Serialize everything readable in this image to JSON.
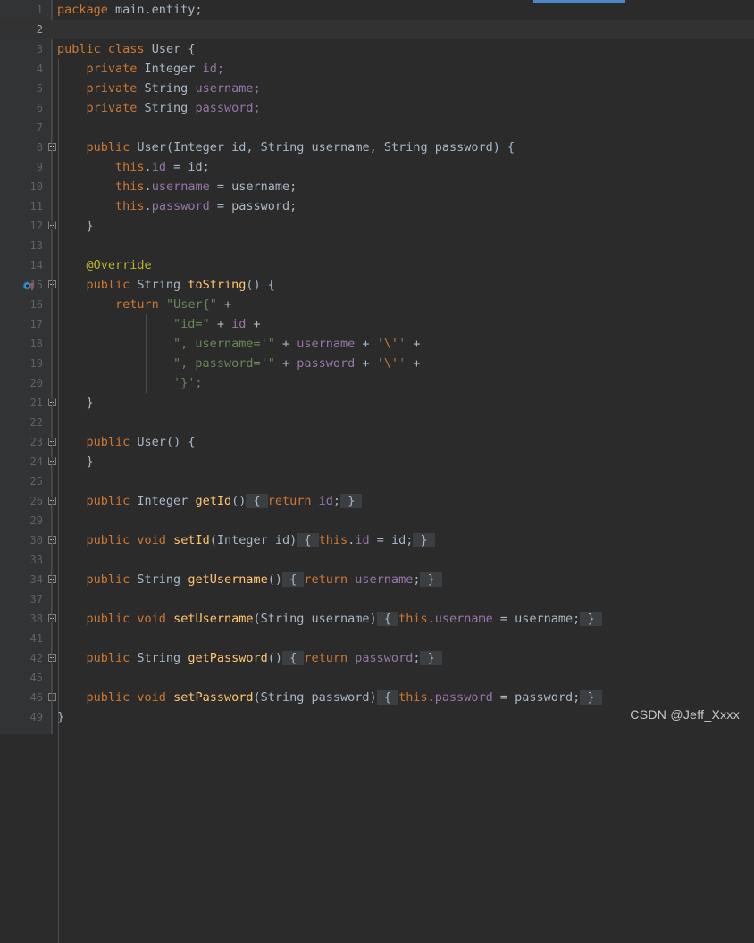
{
  "app": {
    "theme": "darcula",
    "colors": {
      "editor_background": "#2b2b2b",
      "gutter_background": "#313335",
      "current_line": "#323232",
      "keyword": "#cc7832",
      "string": "#6a8759",
      "field": "#9876aa",
      "method": "#ffc66d",
      "annotation": "#bbb529",
      "default_text": "#a9b7c6",
      "line_number": "#606366",
      "fold_placeholder_bg": "#3c3f41",
      "tab_indicator": "#4a88c7"
    }
  },
  "watermark": {
    "text": "CSDN @Jeff_Xxxx"
  },
  "gutter": {
    "override_icon_line": 15,
    "override_icon_name": "overriding-method-icon"
  },
  "editor": {
    "language": "java",
    "lines": [
      {
        "n": "1",
        "current": false,
        "indent": 0,
        "tokens": [
          {
            "t": "package ",
            "c": "kw"
          },
          {
            "t": "main.entity;",
            "c": "id"
          }
        ]
      },
      {
        "n": "2",
        "current": true,
        "indent": 0,
        "tokens": []
      },
      {
        "n": "3",
        "current": false,
        "indent": 0,
        "tokens": [
          {
            "t": "public ",
            "c": "kw"
          },
          {
            "t": "class ",
            "c": "kw"
          },
          {
            "t": "User ",
            "c": "cls"
          },
          {
            "t": "{",
            "c": "id"
          }
        ]
      },
      {
        "n": "4",
        "current": false,
        "indent": 1,
        "tokens": [
          {
            "t": "private ",
            "c": "kw"
          },
          {
            "t": "Integer ",
            "c": "id"
          },
          {
            "t": "id;",
            "c": "fld"
          }
        ]
      },
      {
        "n": "5",
        "current": false,
        "indent": 1,
        "tokens": [
          {
            "t": "private ",
            "c": "kw"
          },
          {
            "t": "String ",
            "c": "id"
          },
          {
            "t": "username;",
            "c": "fld"
          }
        ]
      },
      {
        "n": "6",
        "current": false,
        "indent": 1,
        "tokens": [
          {
            "t": "private ",
            "c": "kw"
          },
          {
            "t": "String ",
            "c": "id"
          },
          {
            "t": "password;",
            "c": "fld"
          }
        ]
      },
      {
        "n": "7",
        "current": false,
        "indent": 0,
        "tokens": []
      },
      {
        "n": "8",
        "current": false,
        "indent": 1,
        "fold": "start",
        "tokens": [
          {
            "t": "public ",
            "c": "kw"
          },
          {
            "t": "User",
            "c": "cls"
          },
          {
            "t": "(",
            "c": "id"
          },
          {
            "t": "Integer ",
            "c": "id"
          },
          {
            "t": "id",
            "c": "id"
          },
          {
            "t": ", ",
            "c": "id"
          },
          {
            "t": "String ",
            "c": "id"
          },
          {
            "t": "username",
            "c": "id"
          },
          {
            "t": ", ",
            "c": "id"
          },
          {
            "t": "String ",
            "c": "id"
          },
          {
            "t": "password",
            "c": "id"
          },
          {
            "t": ") {",
            "c": "id"
          }
        ]
      },
      {
        "n": "9",
        "current": false,
        "indent": 2,
        "tokens": [
          {
            "t": "this",
            "c": "kw"
          },
          {
            "t": ".",
            "c": "id"
          },
          {
            "t": "id",
            "c": "fld"
          },
          {
            "t": " = ",
            "c": "id"
          },
          {
            "t": "id;",
            "c": "id"
          }
        ]
      },
      {
        "n": "10",
        "current": false,
        "indent": 2,
        "tokens": [
          {
            "t": "this",
            "c": "kw"
          },
          {
            "t": ".",
            "c": "id"
          },
          {
            "t": "username",
            "c": "fld"
          },
          {
            "t": " = ",
            "c": "id"
          },
          {
            "t": "username;",
            "c": "id"
          }
        ]
      },
      {
        "n": "11",
        "current": false,
        "indent": 2,
        "tokens": [
          {
            "t": "this",
            "c": "kw"
          },
          {
            "t": ".",
            "c": "id"
          },
          {
            "t": "password",
            "c": "fld"
          },
          {
            "t": " = ",
            "c": "id"
          },
          {
            "t": "password;",
            "c": "id"
          }
        ]
      },
      {
        "n": "12",
        "current": false,
        "indent": 1,
        "fold": "end",
        "tokens": [
          {
            "t": "}",
            "c": "id"
          }
        ]
      },
      {
        "n": "13",
        "current": false,
        "indent": 0,
        "tokens": []
      },
      {
        "n": "14",
        "current": false,
        "indent": 1,
        "tokens": [
          {
            "t": "@Override",
            "c": "ann"
          }
        ]
      },
      {
        "n": "15",
        "current": false,
        "indent": 1,
        "fold": "start",
        "icon": "overriding-method-icon",
        "tokens": [
          {
            "t": "public ",
            "c": "kw"
          },
          {
            "t": "String ",
            "c": "id"
          },
          {
            "t": "toString",
            "c": "mth"
          },
          {
            "t": "() {",
            "c": "id"
          }
        ]
      },
      {
        "n": "16",
        "current": false,
        "indent": 2,
        "tokens": [
          {
            "t": "return ",
            "c": "kw"
          },
          {
            "t": "\"User{\"",
            "c": "str"
          },
          {
            "t": " +",
            "c": "id"
          }
        ]
      },
      {
        "n": "17",
        "current": false,
        "indent": 4,
        "tokens": [
          {
            "t": "\"id=\"",
            "c": "str"
          },
          {
            "t": " + ",
            "c": "id"
          },
          {
            "t": "id",
            "c": "fld"
          },
          {
            "t": " +",
            "c": "id"
          }
        ]
      },
      {
        "n": "18",
        "current": false,
        "indent": 4,
        "tokens": [
          {
            "t": "\", username='\"",
            "c": "str"
          },
          {
            "t": " + ",
            "c": "id"
          },
          {
            "t": "username",
            "c": "fld"
          },
          {
            "t": " + ",
            "c": "id"
          },
          {
            "t": "'",
            "c": "str"
          },
          {
            "t": "\\'",
            "c": "esc"
          },
          {
            "t": "'",
            "c": "str"
          },
          {
            "t": " +",
            "c": "id"
          }
        ]
      },
      {
        "n": "19",
        "current": false,
        "indent": 4,
        "tokens": [
          {
            "t": "\", password='\"",
            "c": "str"
          },
          {
            "t": " + ",
            "c": "id"
          },
          {
            "t": "password",
            "c": "fld"
          },
          {
            "t": " + ",
            "c": "id"
          },
          {
            "t": "'",
            "c": "str"
          },
          {
            "t": "\\'",
            "c": "esc"
          },
          {
            "t": "'",
            "c": "str"
          },
          {
            "t": " +",
            "c": "id"
          }
        ]
      },
      {
        "n": "20",
        "current": false,
        "indent": 4,
        "tokens": [
          {
            "t": "'}';",
            "c": "str"
          }
        ]
      },
      {
        "n": "21",
        "current": false,
        "indent": 1,
        "fold": "end",
        "tokens": [
          {
            "t": "}",
            "c": "id"
          }
        ]
      },
      {
        "n": "22",
        "current": false,
        "indent": 0,
        "tokens": []
      },
      {
        "n": "23",
        "current": false,
        "indent": 1,
        "fold": "start",
        "tokens": [
          {
            "t": "public ",
            "c": "kw"
          },
          {
            "t": "User",
            "c": "cls"
          },
          {
            "t": "() {",
            "c": "id"
          }
        ]
      },
      {
        "n": "24",
        "current": false,
        "indent": 1,
        "fold": "end",
        "tokens": [
          {
            "t": "}",
            "c": "id"
          }
        ]
      },
      {
        "n": "25",
        "current": false,
        "indent": 0,
        "tokens": []
      },
      {
        "n": "26",
        "current": false,
        "indent": 1,
        "fold": "collapsed",
        "tokens": [
          {
            "t": "public ",
            "c": "kw"
          },
          {
            "t": "Integer ",
            "c": "id"
          },
          {
            "t": "getId",
            "c": "mth"
          },
          {
            "t": "()",
            "c": "id"
          },
          {
            "t": " { ",
            "c": "fold"
          },
          {
            "t": "return ",
            "c": "kw"
          },
          {
            "t": "id",
            "c": "fld"
          },
          {
            "t": ";",
            "c": "id"
          },
          {
            "t": " } ",
            "c": "fold"
          }
        ]
      },
      {
        "n": "29",
        "current": false,
        "indent": 0,
        "tokens": []
      },
      {
        "n": "30",
        "current": false,
        "indent": 1,
        "fold": "collapsed",
        "tokens": [
          {
            "t": "public ",
            "c": "kw"
          },
          {
            "t": "void ",
            "c": "kw"
          },
          {
            "t": "setId",
            "c": "mth"
          },
          {
            "t": "(",
            "c": "id"
          },
          {
            "t": "Integer ",
            "c": "id"
          },
          {
            "t": "id",
            "c": "id"
          },
          {
            "t": ")",
            "c": "id"
          },
          {
            "t": " { ",
            "c": "fold"
          },
          {
            "t": "this",
            "c": "kw"
          },
          {
            "t": ".",
            "c": "id"
          },
          {
            "t": "id",
            "c": "fld"
          },
          {
            "t": " = ",
            "c": "id"
          },
          {
            "t": "id;",
            "c": "id"
          },
          {
            "t": " } ",
            "c": "fold"
          }
        ]
      },
      {
        "n": "33",
        "current": false,
        "indent": 0,
        "tokens": []
      },
      {
        "n": "34",
        "current": false,
        "indent": 1,
        "fold": "collapsed",
        "tokens": [
          {
            "t": "public ",
            "c": "kw"
          },
          {
            "t": "String ",
            "c": "id"
          },
          {
            "t": "getUsername",
            "c": "mth"
          },
          {
            "t": "()",
            "c": "id"
          },
          {
            "t": " { ",
            "c": "fold"
          },
          {
            "t": "return ",
            "c": "kw"
          },
          {
            "t": "username",
            "c": "fld"
          },
          {
            "t": ";",
            "c": "id"
          },
          {
            "t": " } ",
            "c": "fold"
          }
        ]
      },
      {
        "n": "37",
        "current": false,
        "indent": 0,
        "tokens": []
      },
      {
        "n": "38",
        "current": false,
        "indent": 1,
        "fold": "collapsed",
        "tokens": [
          {
            "t": "public ",
            "c": "kw"
          },
          {
            "t": "void ",
            "c": "kw"
          },
          {
            "t": "setUsername",
            "c": "mth"
          },
          {
            "t": "(",
            "c": "id"
          },
          {
            "t": "String ",
            "c": "id"
          },
          {
            "t": "username",
            "c": "id"
          },
          {
            "t": ")",
            "c": "id"
          },
          {
            "t": " { ",
            "c": "fold"
          },
          {
            "t": "this",
            "c": "kw"
          },
          {
            "t": ".",
            "c": "id"
          },
          {
            "t": "username",
            "c": "fld"
          },
          {
            "t": " = ",
            "c": "id"
          },
          {
            "t": "username;",
            "c": "id"
          },
          {
            "t": " } ",
            "c": "fold"
          }
        ]
      },
      {
        "n": "41",
        "current": false,
        "indent": 0,
        "tokens": []
      },
      {
        "n": "42",
        "current": false,
        "indent": 1,
        "fold": "collapsed",
        "tokens": [
          {
            "t": "public ",
            "c": "kw"
          },
          {
            "t": "String ",
            "c": "id"
          },
          {
            "t": "getPassword",
            "c": "mth"
          },
          {
            "t": "()",
            "c": "id"
          },
          {
            "t": " { ",
            "c": "fold"
          },
          {
            "t": "return ",
            "c": "kw"
          },
          {
            "t": "password",
            "c": "fld"
          },
          {
            "t": ";",
            "c": "id"
          },
          {
            "t": " } ",
            "c": "fold"
          }
        ]
      },
      {
        "n": "45",
        "current": false,
        "indent": 0,
        "tokens": []
      },
      {
        "n": "46",
        "current": false,
        "indent": 1,
        "fold": "collapsed",
        "tokens": [
          {
            "t": "public ",
            "c": "kw"
          },
          {
            "t": "void ",
            "c": "kw"
          },
          {
            "t": "setPassword",
            "c": "mth"
          },
          {
            "t": "(",
            "c": "id"
          },
          {
            "t": "String ",
            "c": "id"
          },
          {
            "t": "password",
            "c": "id"
          },
          {
            "t": ")",
            "c": "id"
          },
          {
            "t": " { ",
            "c": "fold"
          },
          {
            "t": "this",
            "c": "kw"
          },
          {
            "t": ".",
            "c": "id"
          },
          {
            "t": "password",
            "c": "fld"
          },
          {
            "t": " = ",
            "c": "id"
          },
          {
            "t": "password;",
            "c": "id"
          },
          {
            "t": " } ",
            "c": "fold"
          }
        ]
      },
      {
        "n": "49",
        "current": false,
        "indent": 0,
        "tokens": [
          {
            "t": "}",
            "c": "id"
          }
        ]
      }
    ]
  }
}
